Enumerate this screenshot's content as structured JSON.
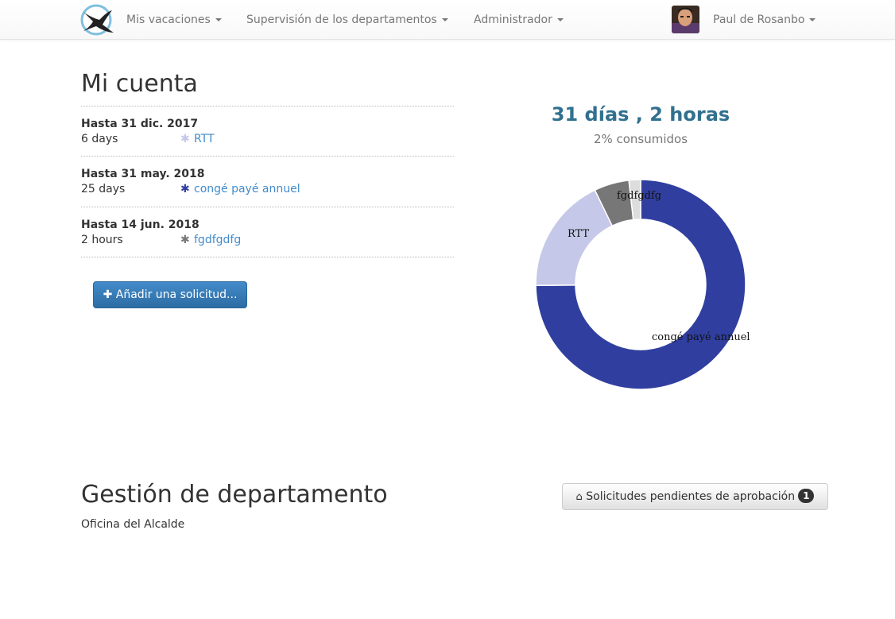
{
  "navbar": {
    "menu1": "Mis vacaciones",
    "menu2": "Supervisión de los departamentos",
    "menu3": "Administrador",
    "user": "Paul de Rosanbo"
  },
  "account": {
    "title": "Mi cuenta",
    "entries": [
      {
        "until": "Hasta 31 dic. 2017",
        "amount": "6 days",
        "type": "RTT",
        "color": "#c5c8e8"
      },
      {
        "until": "Hasta 31 may. 2018",
        "amount": "25 days",
        "type": "congé payé annuel",
        "color": "#303f9f"
      },
      {
        "until": "Hasta 14 jun. 2018",
        "amount": "2 hours",
        "type": "fgdfgdfg",
        "color": "#777777"
      }
    ],
    "add_button": "Añadir una solicitud..."
  },
  "summary": {
    "total": "31 días , 2 horas",
    "consumed": "2% consumidos"
  },
  "chart_data": {
    "type": "pie",
    "donut": true,
    "slices": [
      {
        "name": "congé payé annuel",
        "value": 25,
        "color": "#303f9f"
      },
      {
        "name": "RTT",
        "value": 6,
        "color": "#c5c8e8"
      },
      {
        "name": "fgdfgdfg",
        "value": 1.8,
        "color": "#777777"
      },
      {
        "name": "",
        "value": 0.6,
        "color": "#dddddd"
      }
    ]
  },
  "department": {
    "title": "Gestión de departamento",
    "name": "Oficina del Alcalde",
    "pending_button": "Solicitudes pendientes de aprobación",
    "pending_count": "1"
  }
}
